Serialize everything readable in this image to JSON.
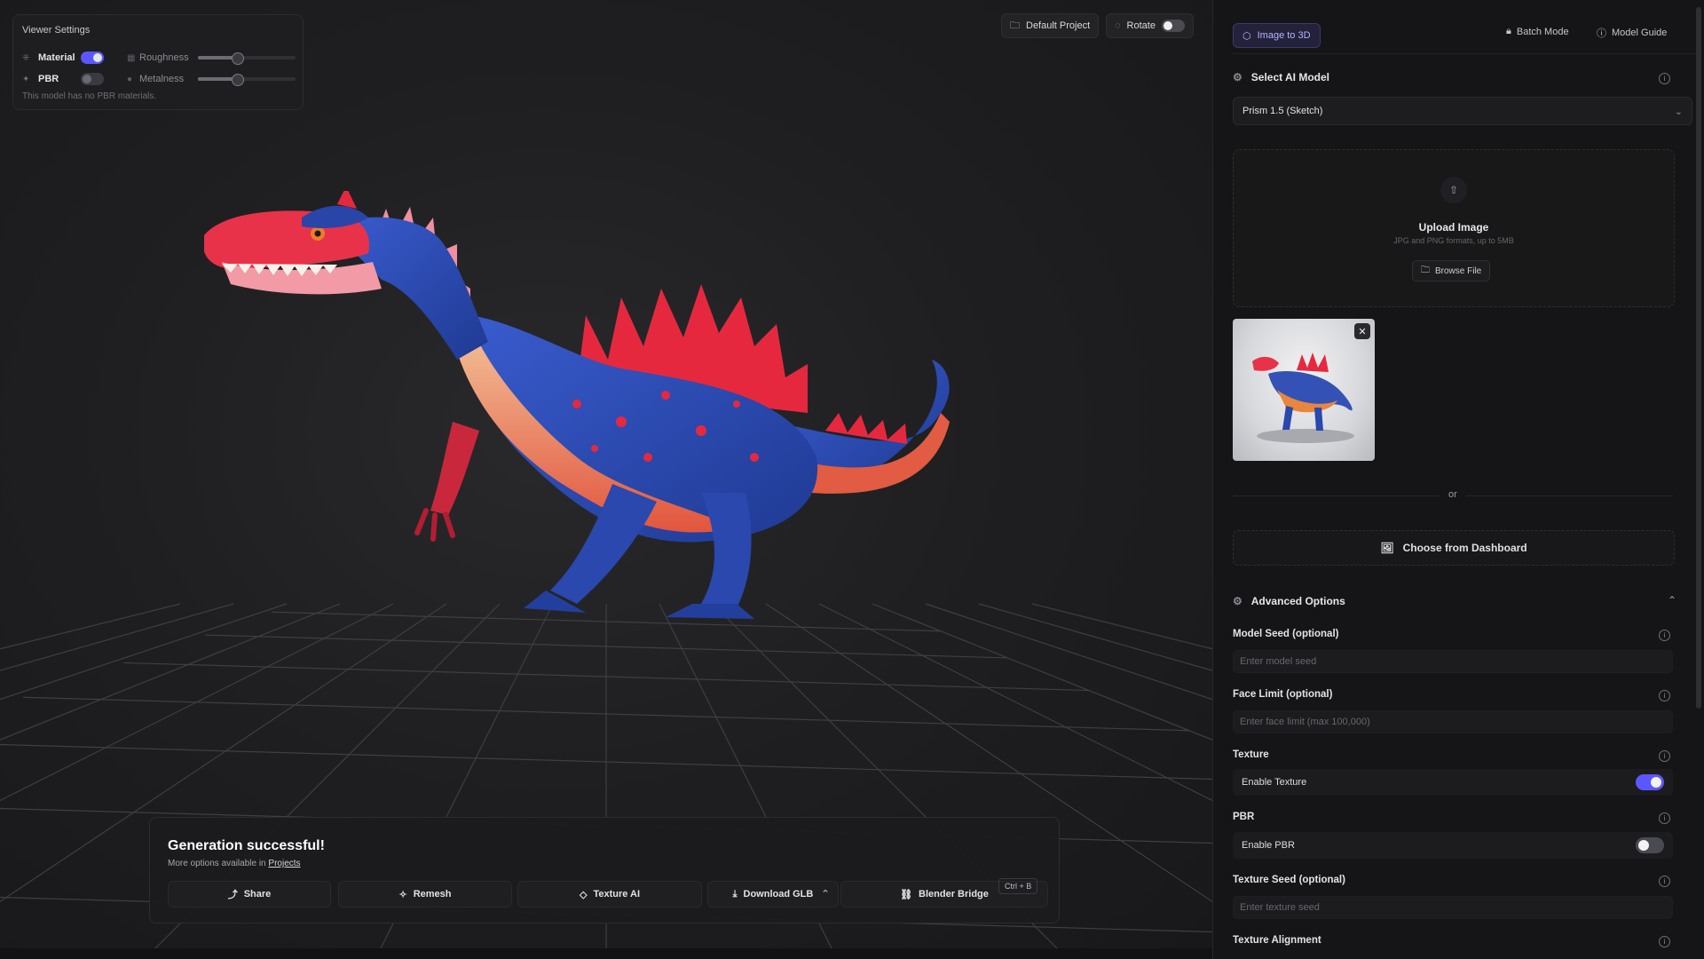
{
  "viewer_settings": {
    "title": "Viewer Settings",
    "material_label": "Material",
    "material_on": true,
    "pbr_label": "PBR",
    "pbr_on": false,
    "roughness_label": "Roughness",
    "roughness_value": 0.4,
    "metalness_label": "Metalness",
    "metalness_value": 0.4,
    "note": "This model has no PBR materials."
  },
  "topbar": {
    "project_label": "Default Project",
    "rotate_label": "Rotate",
    "rotate_on": false
  },
  "generation": {
    "title": "Generation successful!",
    "subtitle_prefix": "More options available in",
    "projects_link": "Projects",
    "actions": {
      "share": "Share",
      "remesh": "Remesh",
      "texture_ai": "Texture AI",
      "download": "Download GLB",
      "blender": "Blender Bridge"
    },
    "shortcut": "Ctrl + B"
  },
  "sidebar": {
    "tabs": {
      "image_to_3d": "Image to 3D",
      "batch_mode": "Batch Mode",
      "model_guide": "Model Guide"
    },
    "select_model_label": "Select AI Model",
    "selected_model": "Prism 1.5 (Sketch)",
    "upload": {
      "title": "Upload Image",
      "hint": "JPG and PNG formats, up to 5MB",
      "browse": "Browse File"
    },
    "or_text": "or",
    "dashboard_button": "Choose from Dashboard",
    "advanced": {
      "title": "Advanced Options",
      "model_seed_label": "Model Seed (optional)",
      "model_seed_placeholder": "Enter model seed",
      "face_limit_label": "Face Limit (optional)",
      "face_limit_placeholder": "Enter face limit (max 100,000)",
      "texture_label": "Texture",
      "enable_texture": "Enable Texture",
      "texture_on": true,
      "pbr_label": "PBR",
      "enable_pbr": "Enable PBR",
      "pbr_on": false,
      "texture_seed_label": "Texture Seed (optional)",
      "texture_seed_placeholder": "Enter texture seed",
      "texture_alignment_label": "Texture Alignment"
    }
  },
  "colors": {
    "accent": "#5b57ff",
    "panel_bg": "#151517",
    "viewport_bg": "#1f1f21",
    "dino_red": "#e8324a",
    "dino_blue": "#2f4fb0",
    "dino_cream": "#efb48a"
  },
  "icons": [
    "folder-icon",
    "rotate-icon",
    "cube-icon",
    "lock-icon",
    "info-icon",
    "gear-icon",
    "upload-icon",
    "close-icon",
    "image-icon",
    "share-icon",
    "sparkle-icon",
    "download-icon",
    "chevron-up-icon",
    "bridge-icon",
    "chevron-down-icon"
  ]
}
